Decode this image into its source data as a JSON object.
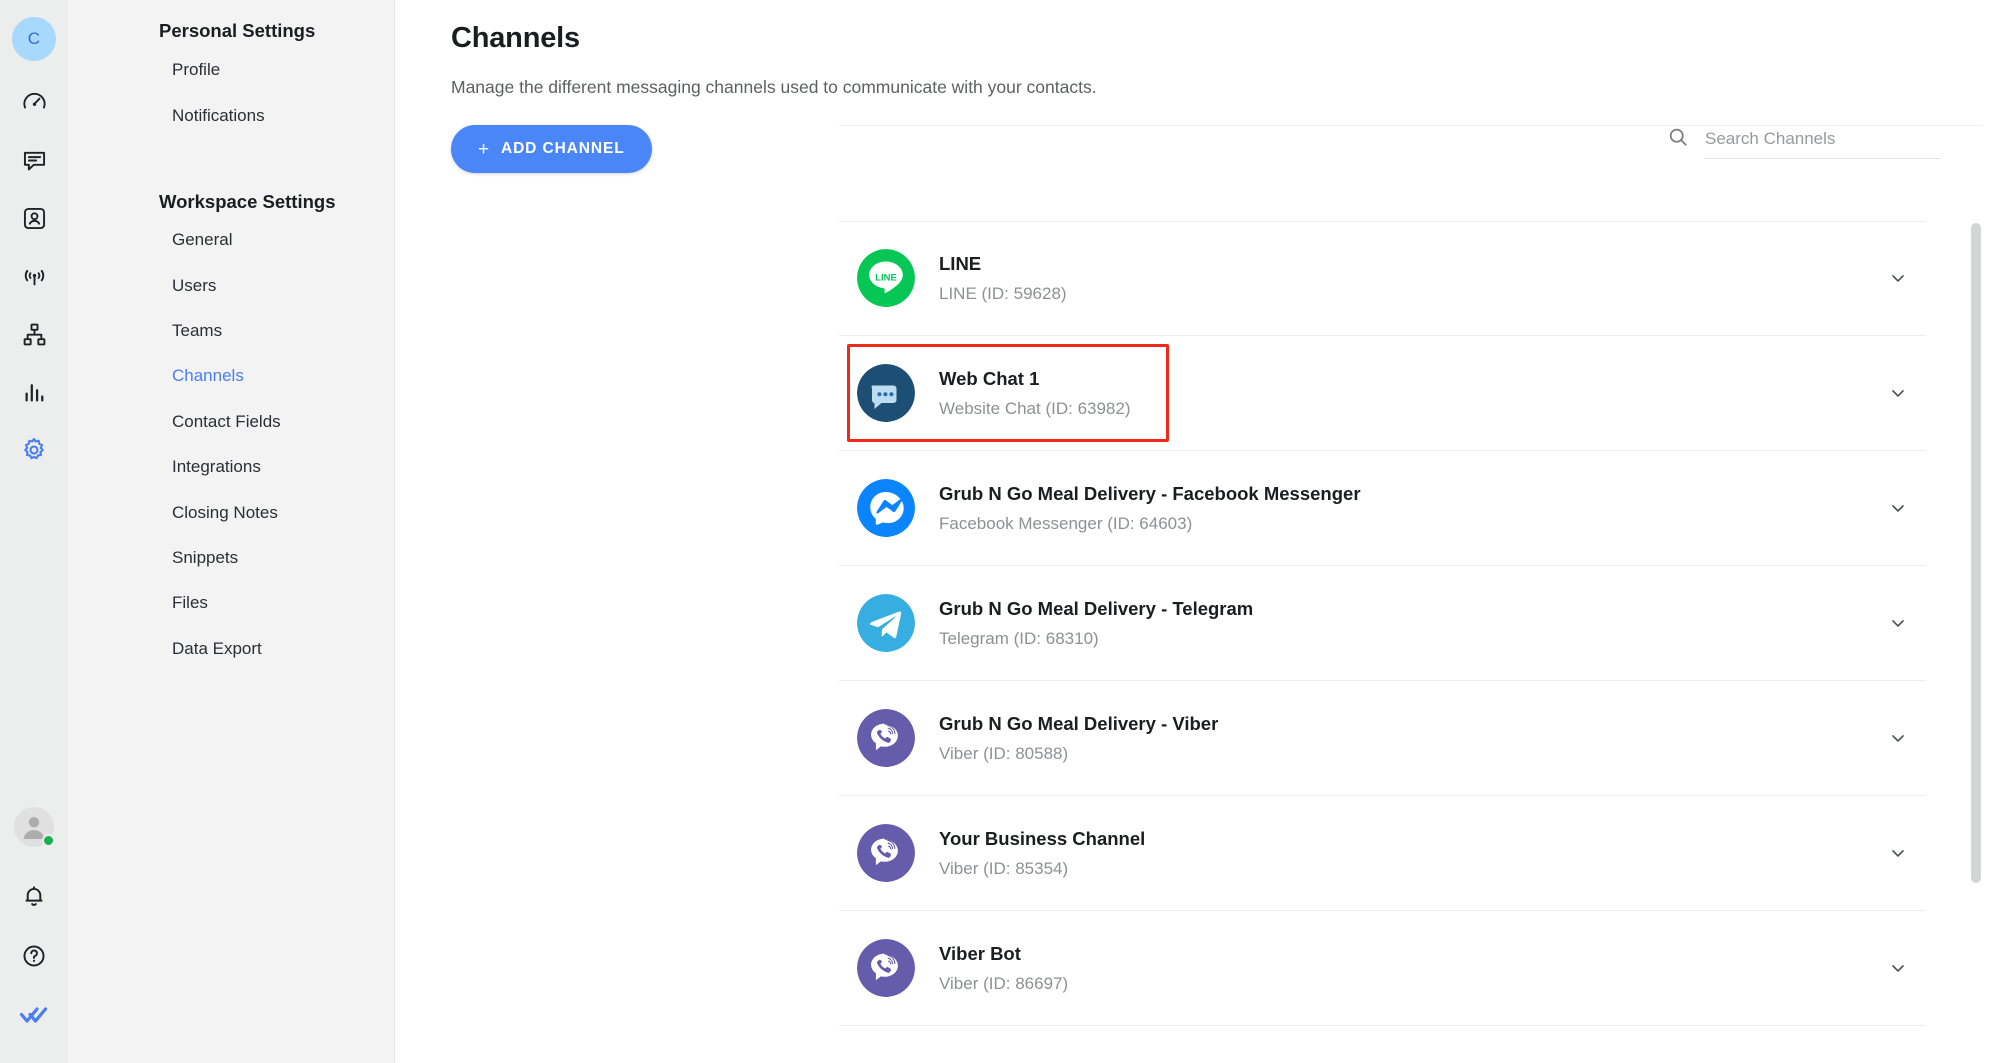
{
  "rail": {
    "workspace_initial": "C",
    "icons": [
      {
        "name": "dashboard-gauge-icon",
        "label": "Dashboard"
      },
      {
        "name": "messages-icon",
        "label": "Messages"
      },
      {
        "name": "contacts-icon",
        "label": "Contacts"
      },
      {
        "name": "broadcast-icon",
        "label": "Broadcasts"
      },
      {
        "name": "workflows-icon",
        "label": "Workflows"
      },
      {
        "name": "reports-icon",
        "label": "Reports"
      },
      {
        "name": "settings-gear-icon",
        "label": "Settings"
      }
    ],
    "bottom": [
      {
        "name": "user-avatar",
        "label": "Account"
      },
      {
        "name": "bell-icon",
        "label": "Notifications"
      },
      {
        "name": "help-icon",
        "label": "Help"
      },
      {
        "name": "brand-logo-icon",
        "label": "Respond.io"
      }
    ],
    "status": "online"
  },
  "nav": {
    "groups": [
      {
        "title": "Personal Settings",
        "items": [
          {
            "label": "Profile",
            "active": false
          },
          {
            "label": "Notifications",
            "active": false
          }
        ]
      },
      {
        "title": "Workspace Settings",
        "items": [
          {
            "label": "General",
            "active": false
          },
          {
            "label": "Users",
            "active": false
          },
          {
            "label": "Teams",
            "active": false
          },
          {
            "label": "Channels",
            "active": true
          },
          {
            "label": "Contact Fields",
            "active": false
          },
          {
            "label": "Integrations",
            "active": false
          },
          {
            "label": "Closing Notes",
            "active": false
          },
          {
            "label": "Snippets",
            "active": false
          },
          {
            "label": "Files",
            "active": false
          },
          {
            "label": "Data Export",
            "active": false
          }
        ]
      }
    ]
  },
  "page": {
    "title": "Channels",
    "subtitle": "Manage the different messaging channels used to communicate with your contacts."
  },
  "toolbar": {
    "add_channel_label": "ADD CHANNEL",
    "add_channel_plus": "+",
    "search_placeholder": "Search Channels",
    "search_value": ""
  },
  "colors": {
    "accent": "#4a86f7",
    "nav_active": "#4a7ef0",
    "highlight_box": "#f02a16",
    "line_green": "#06c755",
    "messenger_blue": "#0a84ff",
    "telegram_blue": "#37aee2",
    "viber_purple": "#665cac",
    "webchat_navy": "#1b4f72",
    "online_green": "#17b04a"
  },
  "channels": [
    {
      "name": "LINE",
      "meta": "LINE (ID: 59628)",
      "type": "LINE",
      "id": "59628",
      "icon": "line-icon",
      "highlighted": false
    },
    {
      "name": "Web Chat 1",
      "meta": "Website Chat (ID: 63982)",
      "type": "Website Chat",
      "id": "63982",
      "icon": "webchat-icon",
      "highlighted": true
    },
    {
      "name": "Grub N Go Meal Delivery - Facebook Messenger",
      "meta": "Facebook Messenger (ID: 64603)",
      "type": "Facebook Messenger",
      "id": "64603",
      "icon": "messenger-icon",
      "highlighted": false
    },
    {
      "name": "Grub N Go Meal Delivery - Telegram",
      "meta": "Telegram (ID: 68310)",
      "type": "Telegram",
      "id": "68310",
      "icon": "telegram-icon",
      "highlighted": false
    },
    {
      "name": "Grub N Go Meal Delivery - Viber",
      "meta": "Viber (ID: 80588)",
      "type": "Viber",
      "id": "80588",
      "icon": "viber-icon",
      "highlighted": false
    },
    {
      "name": "Your Business Channel",
      "meta": "Viber (ID: 85354)",
      "type": "Viber",
      "id": "85354",
      "icon": "viber-icon",
      "highlighted": false
    },
    {
      "name": "Viber Bot",
      "meta": "Viber (ID: 86697)",
      "type": "Viber",
      "id": "86697",
      "icon": "viber-icon",
      "highlighted": false
    }
  ]
}
